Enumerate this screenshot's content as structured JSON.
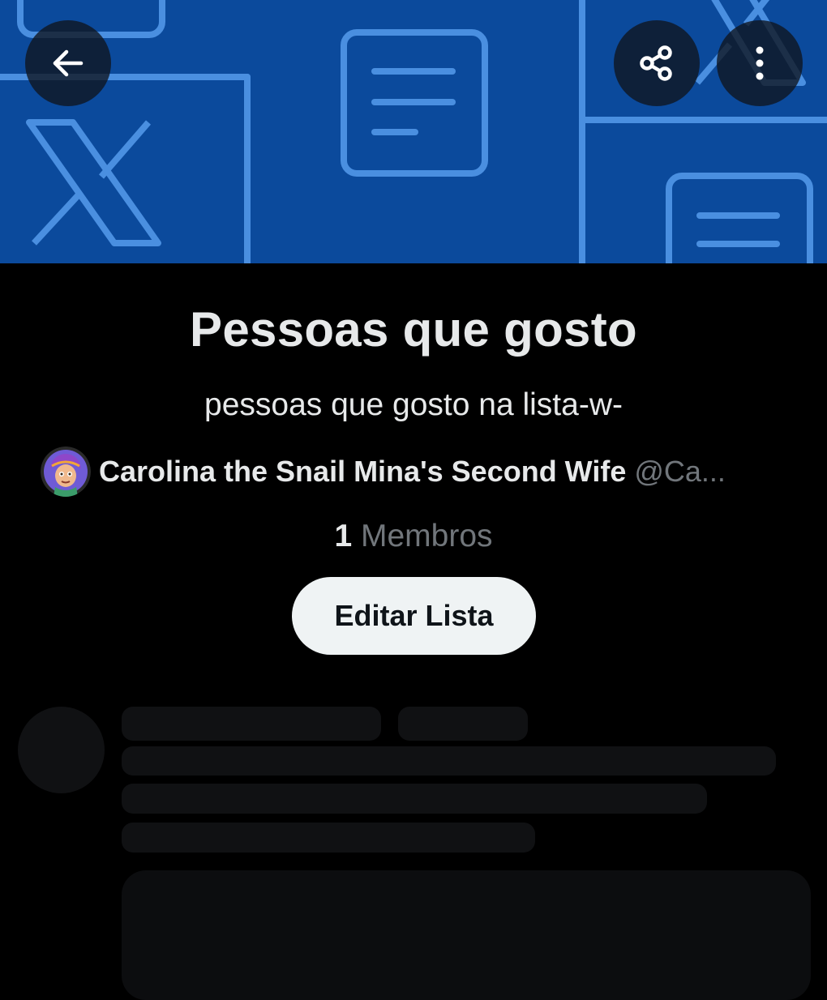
{
  "header": {
    "back_icon": "arrow-left-icon",
    "share_icon": "share-icon",
    "more_icon": "more-vertical-icon"
  },
  "list": {
    "title": "Pessoas que gosto",
    "description": "pessoas que gosto na lista-w-",
    "owner_name": "Carolina the Snail Mina's Second Wife",
    "owner_handle": "@Ca...",
    "members_count": "1",
    "members_label": "Membros",
    "edit_label": "Editar Lista"
  },
  "colors": {
    "banner": "#0b4a9c",
    "banner_lines": "#4a8fe0",
    "background": "#000000",
    "text_primary": "#e7e9ea",
    "text_secondary": "#71767b",
    "button_bg": "#eff3f4",
    "skeleton": "#101113"
  }
}
